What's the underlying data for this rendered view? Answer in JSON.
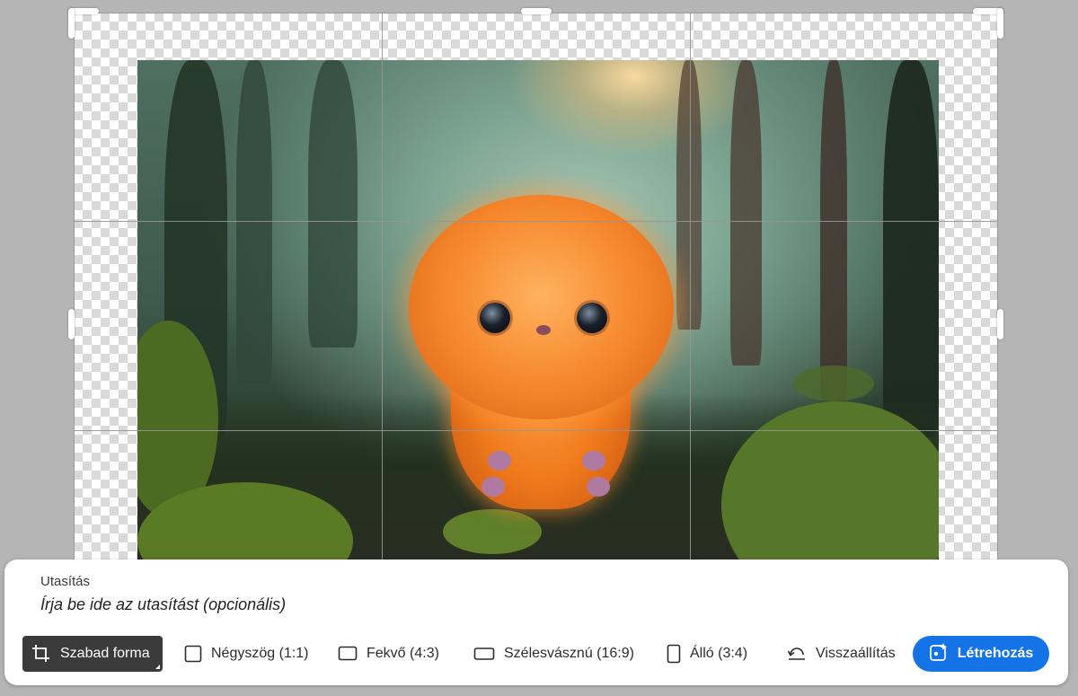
{
  "prompt": {
    "label": "Utasítás",
    "placeholder": "Írja be ide az utasítást (opcionális)"
  },
  "toolbar": {
    "tools": [
      {
        "label": "Szabad forma",
        "icon": "crop-icon",
        "selected": true
      },
      {
        "label": "Négyszög (1:1)",
        "icon": "square-icon",
        "selected": false
      },
      {
        "label": "Fekvő (4:3)",
        "icon": "landscape-icon",
        "selected": false
      },
      {
        "label": "Szélesvásznú (16:9)",
        "icon": "widescreen-icon",
        "selected": false
      },
      {
        "label": "Álló (3:4)",
        "icon": "portrait-icon",
        "selected": false
      }
    ],
    "reset_label": "Visszaállítás",
    "reset_icon": "undo-icon",
    "generate_label": "Létrehozás",
    "generate_icon": "generate-sparkle-icon"
  },
  "colors": {
    "accent": "#1473e6",
    "selected_tool_bg": "#3b3b3b",
    "workspace_bg": "#b5b5b5"
  }
}
